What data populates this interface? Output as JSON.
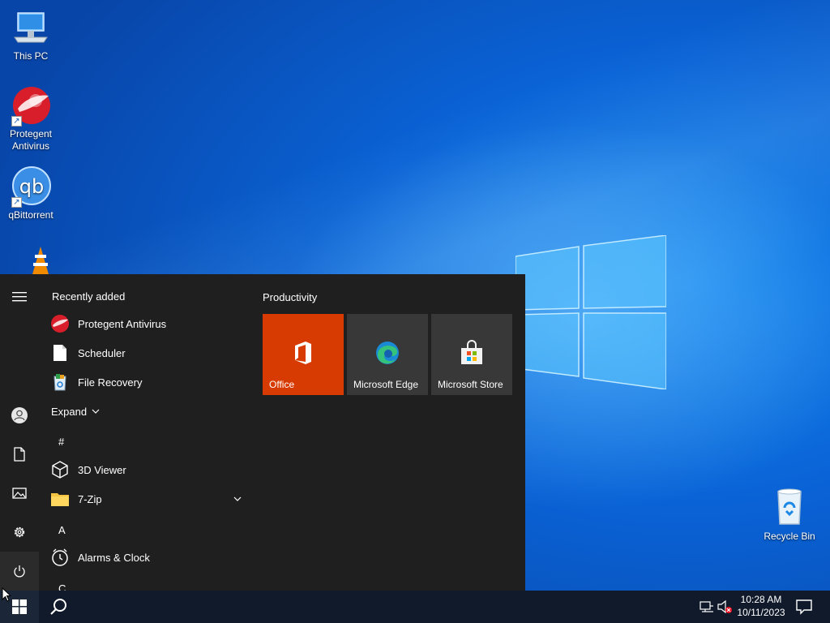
{
  "desktop": {
    "icons": [
      {
        "label": "This PC"
      },
      {
        "label": "Protegent Antivirus"
      },
      {
        "label": "qBittorrent"
      },
      {
        "label": "VLC media player"
      },
      {
        "label": "Recycle Bin"
      }
    ]
  },
  "start_menu": {
    "recently_added_title": "Recently added",
    "recent_items": [
      {
        "label": "Protegent Antivirus",
        "icon": "protegent-icon"
      },
      {
        "label": "Scheduler",
        "icon": "document-icon"
      },
      {
        "label": "File Recovery",
        "icon": "recycle-bin-icon"
      }
    ],
    "expand_label": "Expand",
    "apps": [
      {
        "type": "letter",
        "label": "#"
      },
      {
        "type": "app",
        "label": "3D Viewer",
        "icon": "cube-icon"
      },
      {
        "type": "app",
        "label": "7-Zip",
        "icon": "folder-icon"
      },
      {
        "type": "letter",
        "label": "A"
      },
      {
        "type": "app",
        "label": "Alarms & Clock",
        "icon": "clock-icon"
      },
      {
        "type": "letter",
        "label": "C"
      }
    ],
    "tiles_group_title": "Productivity",
    "tiles": [
      {
        "label": "Office",
        "color": "#d83b01"
      },
      {
        "label": "Microsoft Edge",
        "color": "#3a3a3a"
      },
      {
        "label": "Microsoft Store",
        "color": "#3a3a3a"
      }
    ]
  },
  "taskbar": {
    "time": "10:28 AM",
    "date": "10/11/2023"
  }
}
